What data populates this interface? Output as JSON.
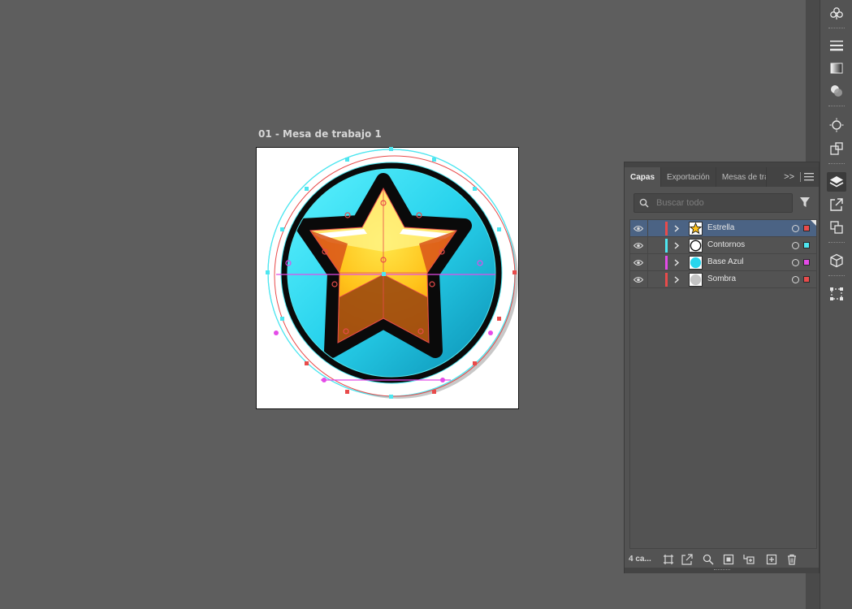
{
  "artboard": {
    "label": "01 - Mesa de trabajo 1"
  },
  "layers_panel": {
    "tabs": [
      {
        "label": "Capas",
        "active": true
      },
      {
        "label": "Exportación",
        "active": false
      },
      {
        "label": "Mesas de tra",
        "active": false
      }
    ],
    "overflow_label": ">>",
    "search_placeholder": "Buscar todo",
    "layers": [
      {
        "name": "Estrella",
        "color": "#e84b4b",
        "selected": true,
        "thumb": "star-thumbnail"
      },
      {
        "name": "Contornos",
        "color": "#4ee6f0",
        "selected": false,
        "thumb": "circle-outline-thumbnail"
      },
      {
        "name": "Base Azul",
        "color": "#e44be8",
        "selected": false,
        "thumb": "blue-disc-thumbnail"
      },
      {
        "name": "Sombra",
        "color": "#e84b4b",
        "selected": false,
        "thumb": "grey-disc-thumbnail"
      }
    ],
    "layer_count": "4 ca...",
    "footer_icons": [
      "collect-for-export-icon",
      "export-icon",
      "locate-object-icon",
      "make-clipping-mask-icon",
      "new-sublayer-icon",
      "new-layer-icon",
      "trash-icon"
    ]
  },
  "dock_icons": [
    "club-symbol-icon",
    "stroke-icon",
    "gradient-icon",
    "transparency-icon",
    "appearance-icon",
    "graphic-styles-icon",
    "layers-icon",
    "export-assets-icon",
    "artboards-icon",
    "3d-icon",
    "transform-icon"
  ],
  "colors": {
    "canvas": "#5e5e5e",
    "selection_red": "#e84b4b",
    "selection_cyan": "#4ee6f0",
    "selection_magenta": "#e44be8",
    "star_yellow": "#ffc21a",
    "disc_cyan": "#27d6ee"
  }
}
